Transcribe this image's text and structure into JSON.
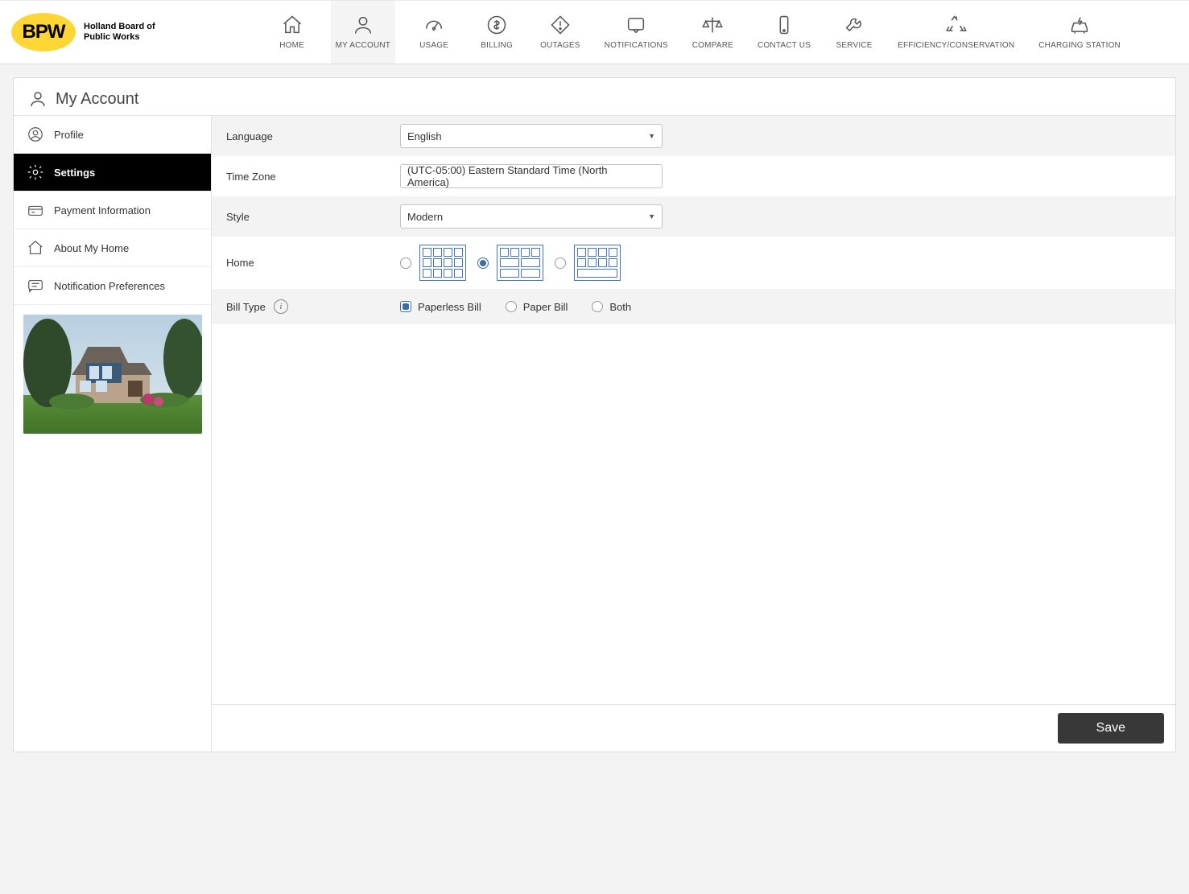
{
  "brand": {
    "logo_text": "BPW",
    "name_line1": "Holland Board of",
    "name_line2": "Public Works"
  },
  "nav": {
    "items": [
      {
        "label": "HOME",
        "icon": "home-icon"
      },
      {
        "label": "MY ACCOUNT",
        "icon": "person-icon",
        "active": true
      },
      {
        "label": "USAGE",
        "icon": "gauge-icon"
      },
      {
        "label": "BILLING",
        "icon": "dollar-icon"
      },
      {
        "label": "OUTAGES",
        "icon": "outage-icon"
      },
      {
        "label": "NOTIFICATIONS",
        "icon": "bell-icon"
      },
      {
        "label": "COMPARE",
        "icon": "scales-icon"
      },
      {
        "label": "CONTACT US",
        "icon": "phone-icon"
      },
      {
        "label": "SERVICE",
        "icon": "wrench-icon"
      },
      {
        "label": "EFFICIENCY/CONSERVATION",
        "icon": "recycle-icon"
      },
      {
        "label": "CHARGING STATION",
        "icon": "car-icon"
      }
    ]
  },
  "page": {
    "title": "My Account"
  },
  "sidebar": {
    "items": [
      {
        "label": "Profile",
        "icon": "profile-icon"
      },
      {
        "label": "Settings",
        "icon": "gear-icon",
        "active": true
      },
      {
        "label": "Payment Information",
        "icon": "payment-icon"
      },
      {
        "label": "About My Home",
        "icon": "house-icon"
      },
      {
        "label": "Notification Preferences",
        "icon": "chat-icon"
      }
    ]
  },
  "form": {
    "language": {
      "label": "Language",
      "value": "English"
    },
    "timezone": {
      "label": "Time Zone",
      "value": "(UTC-05:00) Eastern Standard Time (North America)"
    },
    "style": {
      "label": "Style",
      "value": "Modern"
    },
    "home": {
      "label": "Home",
      "selected_index": 1
    },
    "bill_type": {
      "label": "Bill Type",
      "options": [
        "Paperless Bill",
        "Paper Bill",
        "Both"
      ],
      "selected": "Paperless Bill"
    }
  },
  "actions": {
    "save": "Save"
  }
}
